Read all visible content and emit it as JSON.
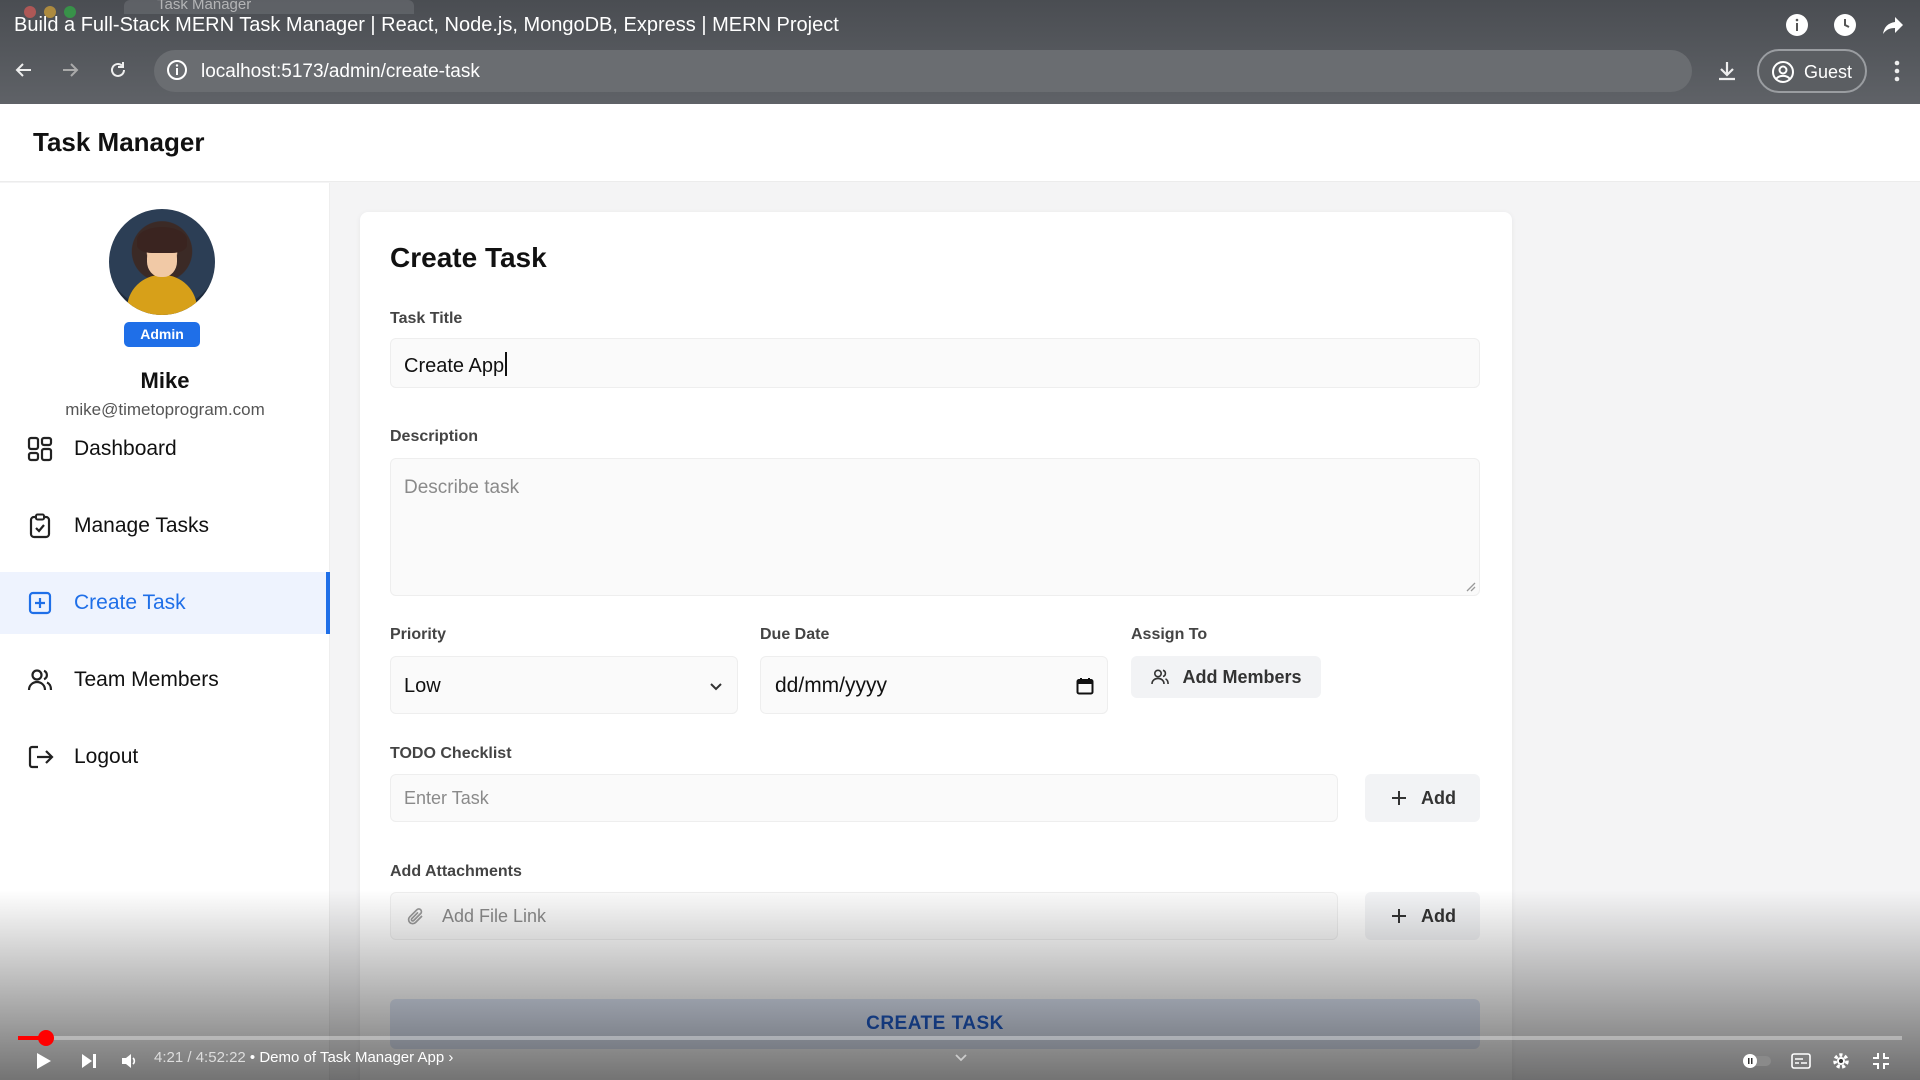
{
  "video": {
    "title": "Build a Full-Stack MERN Task Manager | React, Node.js, MongoDB, Express | MERN Project",
    "ghost_tab": "Task Manager",
    "current_time": "4:21",
    "duration": "4:52:22",
    "time_separator": " / ",
    "chapter": " • Demo of Task Manager App ›",
    "progress": 0.0149,
    "progress_color": "#ff0000"
  },
  "browser": {
    "url": "localhost:5173/admin/create-task",
    "profile_label": "Guest"
  },
  "app": {
    "title": "Task Manager",
    "accent": "#1f6fe8"
  },
  "user": {
    "badge": "Admin",
    "name": "Mike",
    "email": "mike@timetoprogram.com"
  },
  "sidebar": {
    "items": [
      {
        "label": "Dashboard",
        "icon": "dashboard-icon",
        "active": false
      },
      {
        "label": "Manage Tasks",
        "icon": "clipboard-check-icon",
        "active": false
      },
      {
        "label": "Create Task",
        "icon": "plus-square-icon",
        "active": true
      },
      {
        "label": "Team Members",
        "icon": "users-icon",
        "active": false
      },
      {
        "label": "Logout",
        "icon": "logout-icon",
        "active": false
      }
    ]
  },
  "form": {
    "heading": "Create Task",
    "title_label": "Task Title",
    "title_value": "Create App",
    "description_label": "Description",
    "description_placeholder": "Describe task",
    "priority_label": "Priority",
    "priority_value": "Low",
    "due_label": "Due Date",
    "due_placeholder": "dd/mm/yyyy",
    "assign_label": "Assign To",
    "assign_button": "Add Members",
    "todo_label": "TODO Checklist",
    "todo_placeholder": "Enter Task",
    "todo_add": "Add",
    "attach_label": "Add Attachments",
    "attach_placeholder": "Add File Link",
    "attach_add": "Add",
    "submit": "CREATE TASK"
  }
}
